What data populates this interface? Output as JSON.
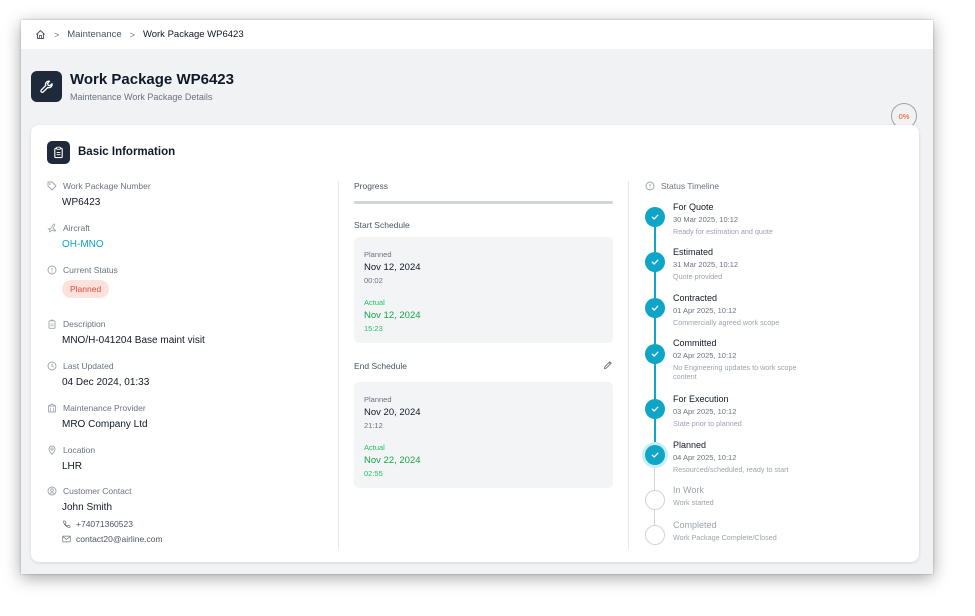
{
  "breadcrumb": {
    "items": [
      "Maintenance",
      "Work Package WP6423"
    ]
  },
  "header": {
    "title": "Work Package WP6423",
    "subtitle": "Maintenance Work Package Details",
    "progress_percent": "0%"
  },
  "card": {
    "title": "Basic Information"
  },
  "fields": {
    "wp_number": {
      "label": "Work Package Number",
      "value": "WP6423",
      "icon": "tag-icon"
    },
    "aircraft": {
      "label": "Aircraft",
      "value": "OH-MNO",
      "icon": "plane-icon"
    },
    "status": {
      "label": "Current Status",
      "value": "Planned",
      "icon": "info-circle-icon"
    },
    "description": {
      "label": "Description",
      "value": "MNO/H-041204 Base maint visit",
      "icon": "clipboard-icon"
    },
    "last_updated": {
      "label": "Last Updated",
      "value": "04 Dec 2024, 01:33",
      "icon": "clock-icon"
    },
    "provider": {
      "label": "Maintenance Provider",
      "value": "MRO Company Ltd",
      "icon": "building-icon"
    },
    "location": {
      "label": "Location",
      "value": "LHR",
      "icon": "map-pin-icon"
    },
    "contact": {
      "label": "Customer Contact",
      "name": "John Smith",
      "phone": "+74071360523",
      "email": "contact20@airline.com",
      "icon": "user-circle-icon"
    }
  },
  "progress": {
    "label": "Progress",
    "value": 0
  },
  "start_schedule": {
    "label": "Start Schedule",
    "planned_label": "Planned",
    "planned_date": "Nov 12, 2024",
    "planned_time": "00:02",
    "actual_label": "Actual",
    "actual_date": "Nov 12, 2024",
    "actual_time": "15:23"
  },
  "end_schedule": {
    "label": "End Schedule",
    "planned_label": "Planned",
    "planned_date": "Nov 20, 2024",
    "planned_time": "21:12",
    "actual_label": "Actual",
    "actual_date": "Nov 22, 2024",
    "actual_time": "02:55"
  },
  "timeline": {
    "label": "Status Timeline",
    "items": [
      {
        "title": "For Quote",
        "date": "30 Mar 2025, 10:12",
        "desc": "Ready for estimation and quote",
        "state": "done"
      },
      {
        "title": "Estimated",
        "date": "31 Mar 2025, 10:12",
        "desc": "Quote provided",
        "state": "done"
      },
      {
        "title": "Contracted",
        "date": "01 Apr 2025, 10:12",
        "desc": "Commercially agreed work scope",
        "state": "done"
      },
      {
        "title": "Committed",
        "date": "02 Apr 2025, 10:12",
        "desc": "No Engineering updates to work scope content",
        "state": "done"
      },
      {
        "title": "For Execution",
        "date": "03 Apr 2025, 10:12",
        "desc": "State prior to planned",
        "state": "done"
      },
      {
        "title": "Planned",
        "date": "04 Apr 2025, 10:12",
        "desc": "Resourced/scheduled, ready to start",
        "state": "current"
      },
      {
        "title": "In Work",
        "date": "",
        "desc": "Work started",
        "state": "todo"
      },
      {
        "title": "Completed",
        "date": "",
        "desc": "Work Package Complete/Closed",
        "state": "todo"
      }
    ]
  },
  "colors": {
    "accent": "#0ea5c6",
    "dark": "#1e2a3a",
    "status_badge_bg": "#fde2dc",
    "status_badge_text": "#dc4c3e",
    "actual_green": "#16a34a",
    "percent_orange": "#ea580c"
  }
}
